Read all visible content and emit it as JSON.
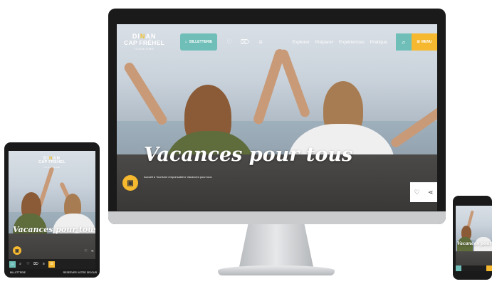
{
  "site": {
    "logo_line1_a": "DI",
    "logo_line1_accent": "N",
    "logo_line1_b": "AN",
    "logo_line2": "CAP FRÉHEL",
    "logo_line3": "TOURISME"
  },
  "header": {
    "billetterie_label": "BILLETTERIE",
    "nav": [
      "Explorer",
      "Préparer",
      "Expériences",
      "Pratique"
    ],
    "menu_label": "MENU"
  },
  "hero": {
    "title": "Vacances pour tous",
    "breadcrumb": [
      "Accueil",
      "Tourisme responsable",
      "Vacances pour tous"
    ]
  },
  "tablet": {
    "bottom_left": "BILLETTERIE",
    "bottom_right": "RESERVER VOTRE SEJOUR"
  },
  "icons": {
    "ticket": "ticket-icon",
    "heart": "heart-icon",
    "tag": "tag-icon",
    "list": "list-icon",
    "search": "search-icon",
    "hamburger": "hamburger-icon",
    "chat": "chat-icon",
    "share": "share-icon"
  },
  "colors": {
    "teal": "#6fbfb8",
    "yellow": "#f5b82e"
  }
}
